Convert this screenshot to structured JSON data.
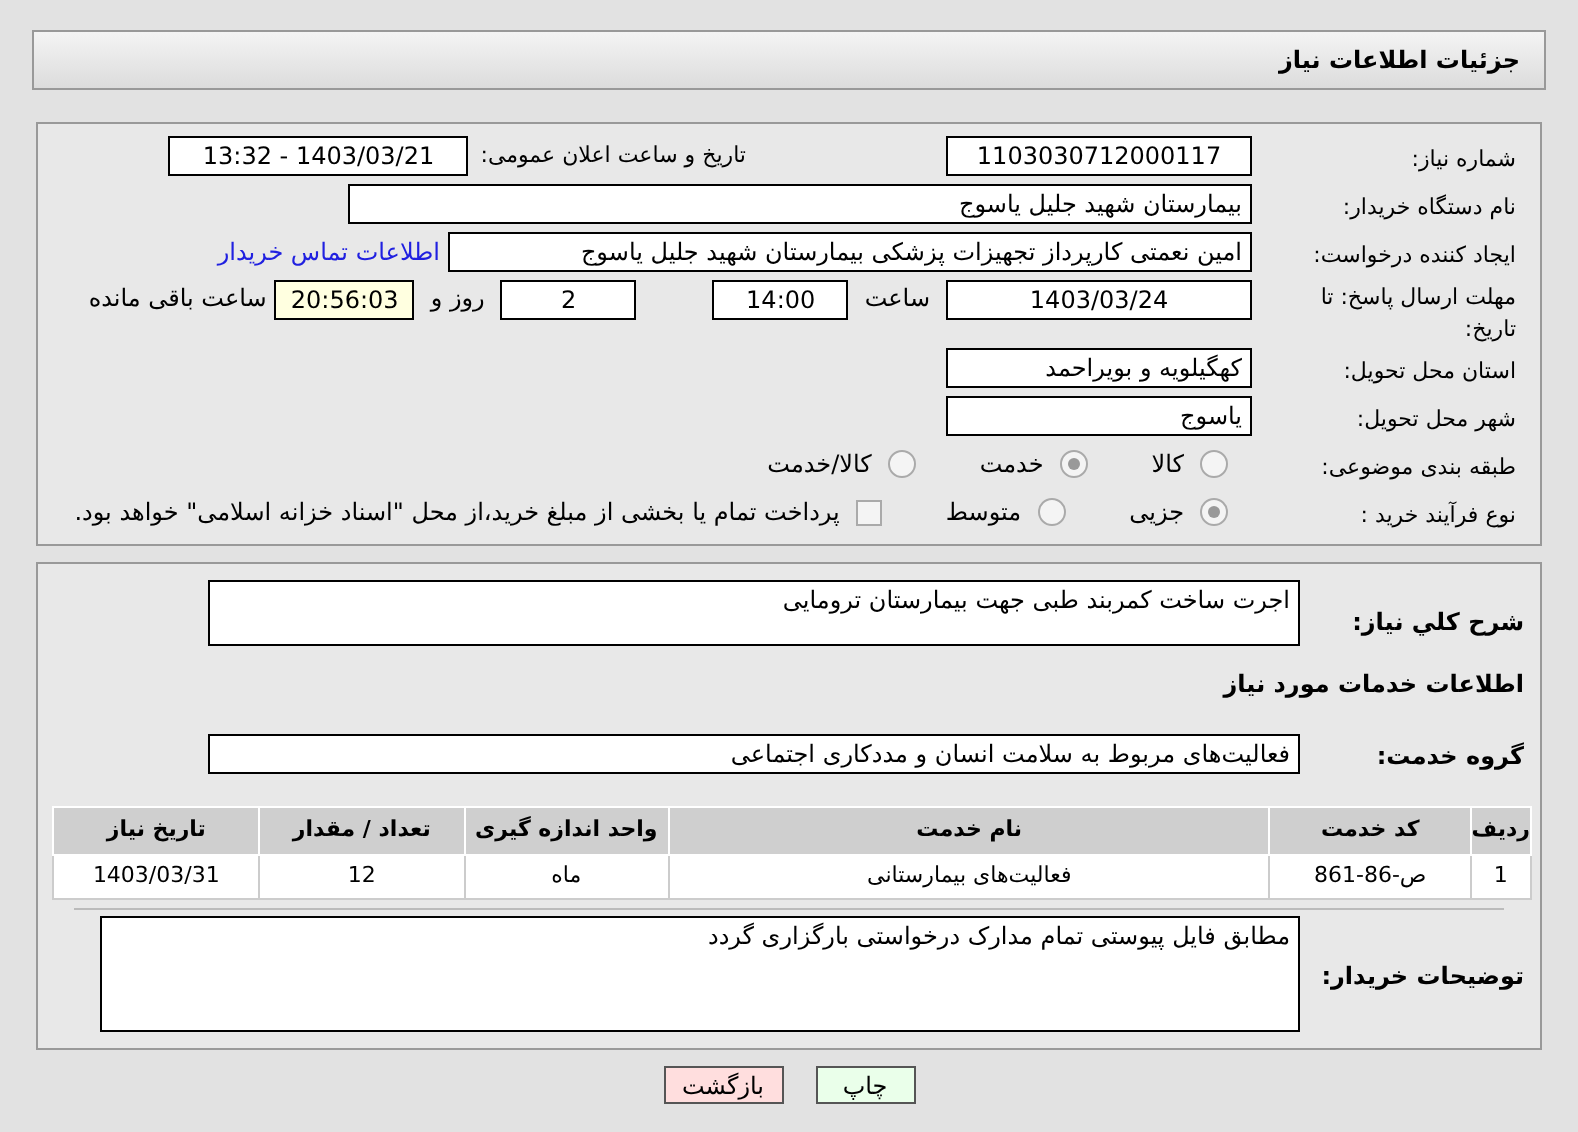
{
  "header": {
    "title": "جزئیات اطلاعات نیاز"
  },
  "need_number": {
    "label": "شماره نیاز:",
    "value": "1103030712000117"
  },
  "announce": {
    "label": "تاریخ و ساعت اعلان عمومی:",
    "value": "1403/03/21 - 13:32"
  },
  "buyer": {
    "label": "نام دستگاه خریدار:",
    "value": "بیمارستان شهید جلیل یاسوج"
  },
  "creator": {
    "label": "ایجاد کننده درخواست:",
    "value": "امین نعمتی کارپرداز تجهیزات پزشکی بیمارستان شهید جلیل یاسوج",
    "link": "اطلاعات تماس خریدار"
  },
  "deadline": {
    "label": "مهلت ارسال پاسخ: تا تاریخ:",
    "date": "1403/03/24",
    "time_label": "ساعت",
    "time": "14:00",
    "days": "2",
    "days_label": "روز و",
    "remaining": "20:56:03",
    "remaining_label": "ساعت باقی مانده"
  },
  "province": {
    "label": "استان محل تحویل:",
    "value": "کهگیلویه و بویراحمد"
  },
  "city": {
    "label": "شهر محل تحویل:",
    "value": "یاسوج"
  },
  "category": {
    "label": "طبقه بندی موضوعی:",
    "options": [
      {
        "label": "کالا",
        "selected": false
      },
      {
        "label": "خدمت",
        "selected": true
      },
      {
        "label": "کالا/خدمت",
        "selected": false
      }
    ]
  },
  "process": {
    "label": "نوع فرآیند خرید :",
    "options": [
      {
        "label": "جزیی",
        "selected": true
      },
      {
        "label": "متوسط",
        "selected": false
      }
    ],
    "treasury": {
      "label": "پرداخت تمام یا بخشی از مبلغ خرید،از محل \"اسناد خزانه اسلامی\" خواهد بود.",
      "checked": false
    }
  },
  "description": {
    "label": "شرح کلي نياز:",
    "value": "اجرت ساخت کمربند طبی جهت بیمارستان ترومایی"
  },
  "services_title": "اطلاعات خدمات مورد نیاز",
  "service_group": {
    "label": "گروه خدمت:",
    "value": "فعالیت‌های مربوط به سلامت انسان و مددکاری اجتماعی"
  },
  "table": {
    "columns": [
      "ردیف",
      "کد خدمت",
      "نام خدمت",
      "واحد اندازه گیری",
      "تعداد / مقدار",
      "تاریخ نیاز"
    ],
    "rows": [
      [
        "1",
        "ص-86-861",
        "فعالیت‌های بیمارستانی",
        "ماه",
        "12",
        "1403/03/31"
      ]
    ]
  },
  "buyer_notes": {
    "label": "توضیحات خریدار:",
    "value": "مطابق فایل پیوستی تمام مدارک درخواستی بارگزاری گردد"
  },
  "buttons": [
    {
      "label": "چاپ",
      "kind": "print"
    },
    {
      "label": "بازگشت",
      "kind": "back"
    }
  ]
}
